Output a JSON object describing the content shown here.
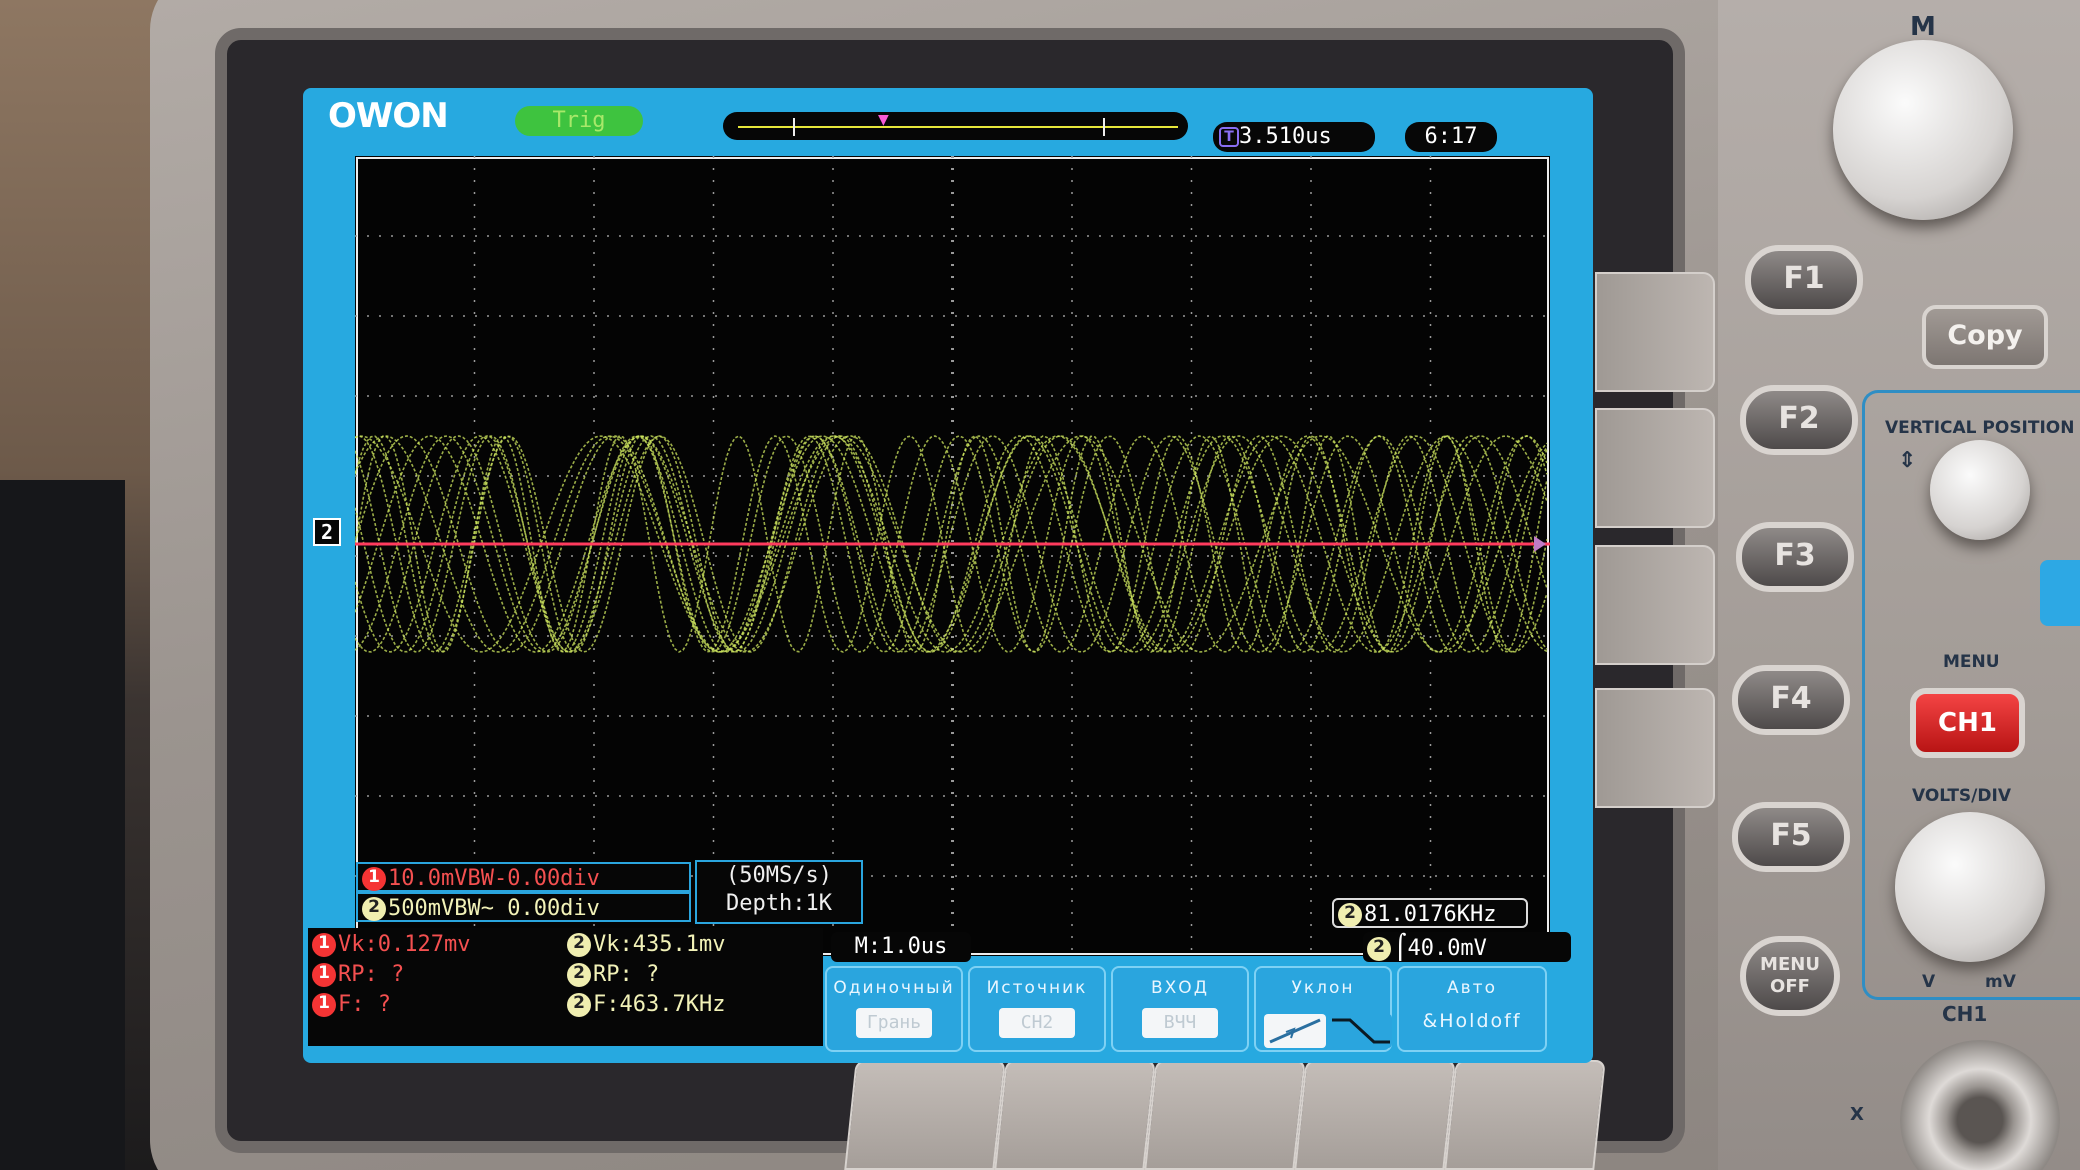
{
  "top": {
    "brand": "OWON",
    "trigger_status": "Trig",
    "trigger_delay": "3.510us",
    "trigger_icon_label": "T",
    "clock": "6:17"
  },
  "waveform": {
    "ch2_marker": "2",
    "ch1_color": "#ff3b5e",
    "ch2_color": "#cde55f"
  },
  "channels": {
    "ch1_setting": "10.0mVBW-0.00div",
    "ch2_setting": "500mVBW~ 0.00div",
    "ch1_num": "1",
    "ch2_num": "2",
    "sample_rate": "(50MS/s)",
    "depth": "Depth:1K",
    "frequency": "81.0176KHz"
  },
  "measurements": {
    "ch1": [
      {
        "label": "Vk:0.127mv"
      },
      {
        "label": "RP:  ?"
      },
      {
        "label": "F:  ?"
      }
    ],
    "ch2": [
      {
        "label": "Vk:435.1mv"
      },
      {
        "label": "RP:  ?"
      },
      {
        "label": "F:463.7KHz"
      }
    ]
  },
  "timebase": "M:1.0us",
  "trigger_level": "40.0mV",
  "menu": [
    {
      "title": "Одиночный",
      "value": "Грань"
    },
    {
      "title": "Источник",
      "value": "CH2"
    },
    {
      "title": "ВХОД",
      "value": "ВЧЧ"
    },
    {
      "title": "Уклон",
      "value": ""
    },
    {
      "title": "Авто",
      "value": "&Holdoff"
    }
  ],
  "panel": {
    "m_label": "M",
    "f_keys": [
      "F1",
      "F2",
      "F3",
      "F4",
      "F5"
    ],
    "copy": "Copy",
    "vertical_position": "VERTICAL  POSITION",
    "menu_label": "MENU",
    "ch1_button": "CH1",
    "volts_div": "VOLTS/DIV",
    "menu_off": "MENU OFF",
    "v_label": "V",
    "mv_label": "mV",
    "ch1_label": "CH1",
    "x_label": "X"
  }
}
